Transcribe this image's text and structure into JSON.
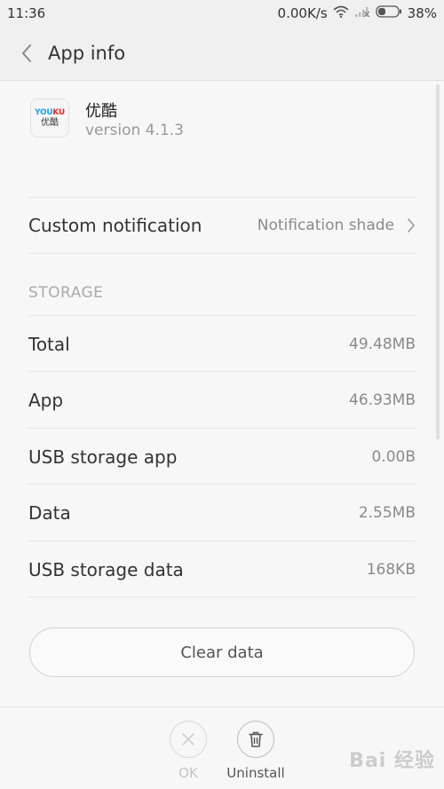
{
  "status_bar": {
    "time": "11:36",
    "speed": "0.00K/s",
    "battery": "38%",
    "battery_level": 0.38
  },
  "header": {
    "title": "App info"
  },
  "app": {
    "name": "优酷",
    "version": "version 4.1.3",
    "icon_brand_part1": "YOU",
    "icon_brand_part2": "KU",
    "icon_brand_cn": "优酷"
  },
  "notification_row": {
    "label": "Custom notification",
    "value": "Notification shade"
  },
  "storage": {
    "section_title": "STORAGE",
    "rows": [
      {
        "label": "Total",
        "value": "49.48MB"
      },
      {
        "label": "App",
        "value": "46.93MB"
      },
      {
        "label": "USB storage app",
        "value": "0.00B"
      },
      {
        "label": "Data",
        "value": "2.55MB"
      },
      {
        "label": "USB storage data",
        "value": "168KB"
      }
    ]
  },
  "clear_button": {
    "label": "Clear data"
  },
  "bottom_actions": {
    "ok_label": "OK",
    "uninstall_label": "Uninstall"
  },
  "watermark": {
    "text": "Bai 经验"
  },
  "icons": {
    "back": "chevron-left-icon",
    "chevron_right": "chevron-right-icon",
    "wifi": "wifi-icon",
    "signal": "signal-icon",
    "battery": "battery-icon",
    "ok": "close-icon",
    "uninstall": "trash-icon"
  },
  "colors": {
    "background": "#f7f7f7",
    "bar_background": "#f0f0f0",
    "divider": "#e6e6e6",
    "value_text": "#8a8a8a",
    "section_text": "#aaaaaa"
  }
}
